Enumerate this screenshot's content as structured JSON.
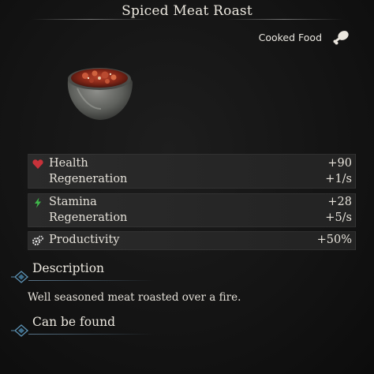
{
  "header": {
    "title": "Spiced Meat Roast"
  },
  "category": {
    "label": "Cooked Food",
    "icon": "meat-drumstick-icon"
  },
  "item": {
    "image": "spiced-meat-roast-bowl"
  },
  "stats": {
    "health": {
      "icon": "heart-icon",
      "icon_color": "#c8323a",
      "label": "Health",
      "value": "+90",
      "regen_label": "Regeneration",
      "regen_value": "+1/s"
    },
    "stamina": {
      "icon": "lightning-icon",
      "icon_color": "#3fb84a",
      "label": "Stamina",
      "value": "+28",
      "regen_label": "Regeneration",
      "regen_value": "+5/s"
    },
    "productivity": {
      "icon": "gears-icon",
      "icon_color": "#e6e6e6",
      "label": "Productivity",
      "value": "+50%"
    }
  },
  "sections": {
    "description": {
      "title": "Description",
      "text": "Well seasoned meat roasted over a fire."
    },
    "found": {
      "title": "Can be found"
    }
  },
  "colors": {
    "background": "#141414",
    "stat_box": "#292929",
    "accent_diamond": "#5b8fb0"
  }
}
